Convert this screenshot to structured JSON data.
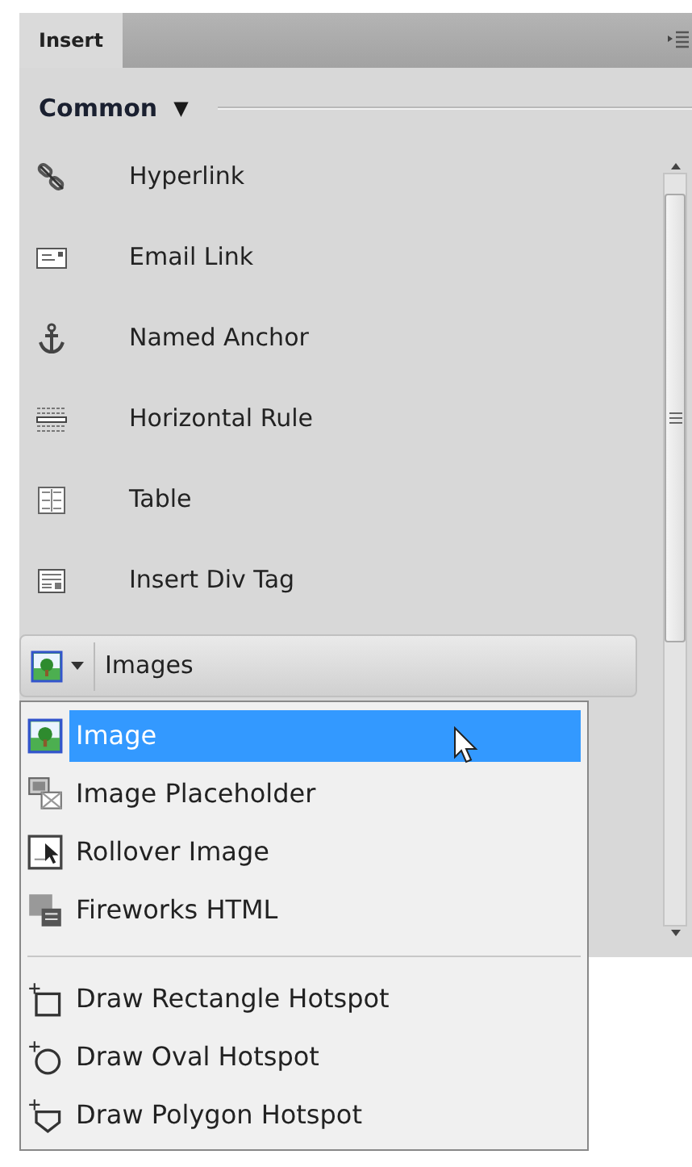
{
  "panel": {
    "tabs": [
      {
        "label": "Insert",
        "selected": true
      }
    ],
    "category": {
      "label": "Common",
      "caret": "▼"
    },
    "items": [
      {
        "label": "Hyperlink"
      },
      {
        "label": "Email Link"
      },
      {
        "label": "Named Anchor"
      },
      {
        "label": "Horizontal Rule"
      },
      {
        "label": "Table"
      },
      {
        "label": "Insert Div Tag"
      }
    ],
    "images_button": {
      "label": "Images"
    },
    "menu": {
      "groups": [
        [
          {
            "label": "Image",
            "selected": true
          },
          {
            "label": "Image Placeholder",
            "selected": false
          },
          {
            "label": "Rollover Image",
            "selected": false
          },
          {
            "label": "Fireworks HTML",
            "selected": false
          }
        ],
        [
          {
            "label": "Draw Rectangle Hotspot",
            "selected": false
          },
          {
            "label": "Draw Oval Hotspot",
            "selected": false
          },
          {
            "label": "Draw Polygon Hotspot",
            "selected": false
          }
        ]
      ]
    }
  }
}
